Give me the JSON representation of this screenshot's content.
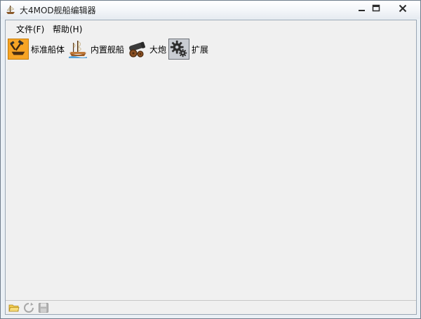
{
  "window": {
    "title": "大4MOD舰船编辑器",
    "controls": {
      "minimize_icon": "minimize-icon",
      "maximize_icon": "maximize-icon",
      "close_icon": "close-icon"
    }
  },
  "menu": {
    "items": [
      {
        "label": "文件(F)"
      },
      {
        "label": "帮助(H)"
      }
    ]
  },
  "toolbar": {
    "buttons": [
      {
        "label": "标准船体",
        "icon": "hammer-hull-icon",
        "accent": "#f6a425"
      },
      {
        "label": "内置舰船",
        "icon": "sailing-ship-icon"
      },
      {
        "label": "大炮",
        "icon": "cannon-icon"
      },
      {
        "label": "扩展",
        "icon": "gear-icon",
        "accent": "#c9ccd2"
      }
    ]
  },
  "statusbar": {
    "icons": [
      "open-folder-icon",
      "refresh-icon",
      "save-icon"
    ]
  },
  "colors": {
    "client_bg": "#f0f0f0",
    "desktop_bg": "#6b4a2e"
  }
}
